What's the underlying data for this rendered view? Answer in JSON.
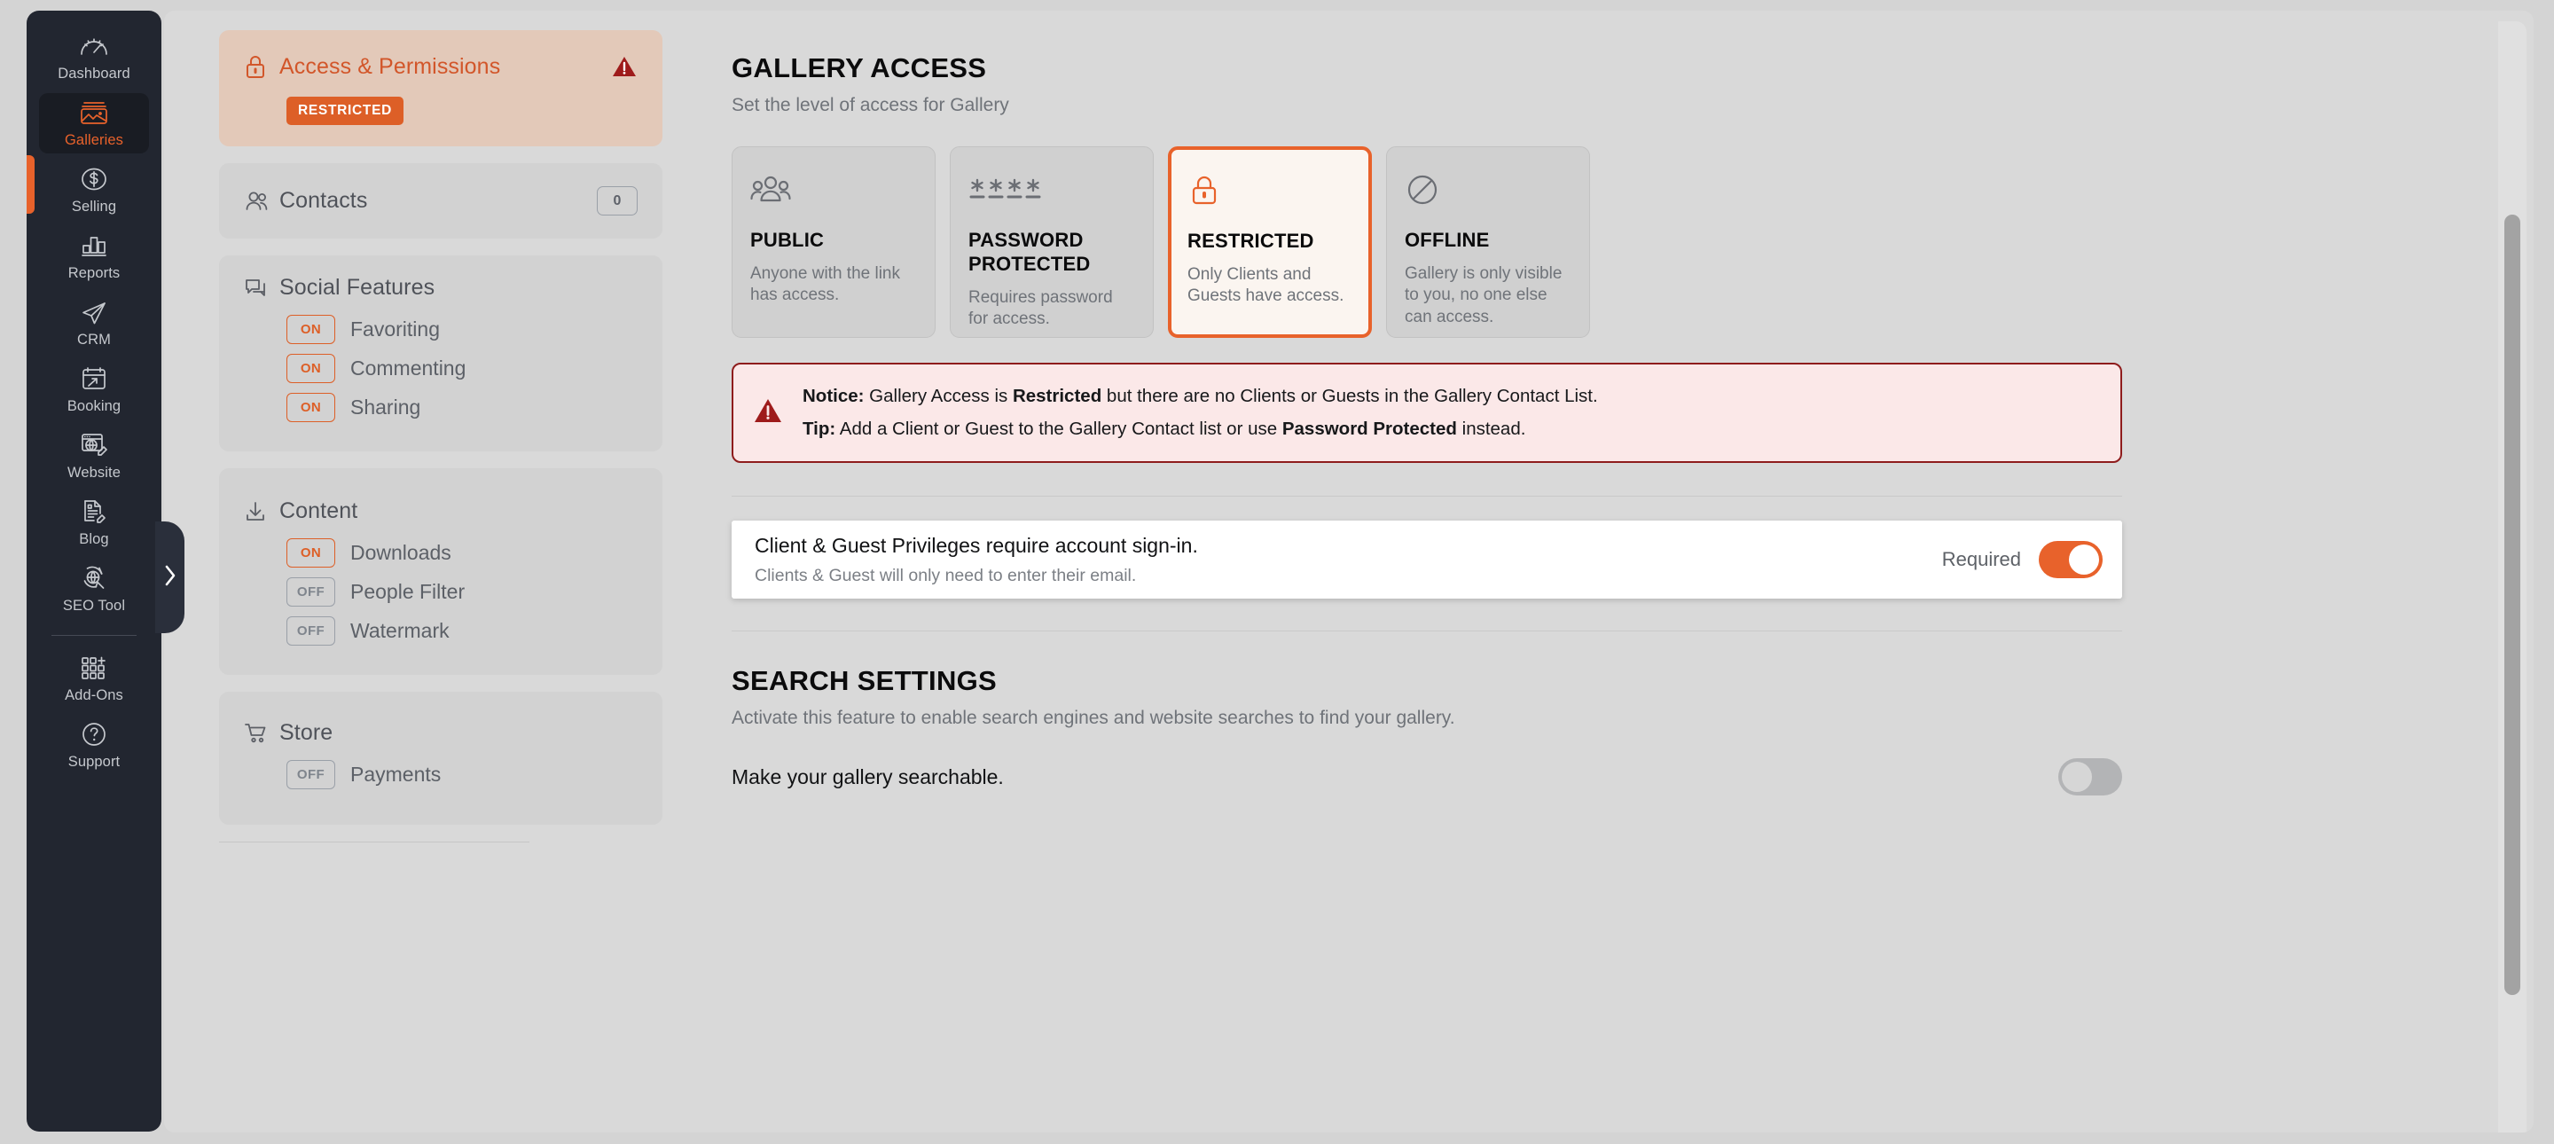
{
  "sidebar": {
    "items": [
      {
        "label": "Dashboard",
        "icon": "gauge-icon",
        "active": false
      },
      {
        "label": "Galleries",
        "icon": "image-stack-icon",
        "active": true
      },
      {
        "label": "Selling",
        "icon": "dollar-circle-icon",
        "active": false
      },
      {
        "label": "Reports",
        "icon": "bar-chart-icon",
        "active": false
      },
      {
        "label": "CRM",
        "icon": "paper-plane-icon",
        "active": false
      },
      {
        "label": "Booking",
        "icon": "calendar-arrow-icon",
        "active": false
      },
      {
        "label": "Website",
        "icon": "browser-globe-pencil-icon",
        "active": false
      },
      {
        "label": "Blog",
        "icon": "document-pencil-icon",
        "active": false
      },
      {
        "label": "SEO Tool",
        "icon": "globe-refresh-search-icon",
        "active": false
      },
      {
        "label": "Add-Ons",
        "icon": "grid-plus-icon",
        "active": false
      },
      {
        "label": "Support",
        "icon": "question-circle-icon",
        "active": false
      }
    ],
    "collapse_icon": "chevron-right-icon",
    "accent_color": "#e8622b",
    "background_color": "#222630"
  },
  "settings_panel": {
    "access": {
      "icon": "lock-icon",
      "title": "Access & Permissions",
      "warning_icon": "warning-triangle-icon",
      "badge": "RESTRICTED",
      "badge_color": "#dd5f27",
      "panel_color": "#e3c9b9"
    },
    "contacts": {
      "icon": "people-icon",
      "title": "Contacts",
      "count": "0"
    },
    "social": {
      "icon": "chat-bubbles-icon",
      "title": "Social Features",
      "features": [
        {
          "state": "ON",
          "label": "Favoriting"
        },
        {
          "state": "ON",
          "label": "Commenting"
        },
        {
          "state": "ON",
          "label": "Sharing"
        }
      ]
    },
    "content": {
      "icon": "download-icon",
      "title": "Content",
      "features": [
        {
          "state": "ON",
          "label": "Downloads"
        },
        {
          "state": "OFF",
          "label": "People Filter"
        },
        {
          "state": "OFF",
          "label": "Watermark"
        }
      ]
    },
    "store": {
      "icon": "shopping-cart-icon",
      "title": "Store",
      "features": [
        {
          "state": "OFF",
          "label": "Payments"
        }
      ]
    }
  },
  "gallery_access": {
    "title": "GALLERY ACCESS",
    "subtitle": "Set the level of access for Gallery",
    "options": [
      {
        "icon": "people-group-icon",
        "name": "PUBLIC",
        "description": "Anyone with the link has access.",
        "selected": false
      },
      {
        "icon": "password-asterisks-icon",
        "name": "PASSWORD PROTECTED",
        "description": "Requires password for access.",
        "selected": false
      },
      {
        "icon": "lock-icon",
        "name": "RESTRICTED",
        "description": "Only Clients and Guests have access.",
        "selected": true
      },
      {
        "icon": "no-entry-icon",
        "name": "OFFLINE",
        "description": "Gallery is only visible to you, no one else can access.",
        "selected": false
      }
    ],
    "selected_color": "#e8622b"
  },
  "notice": {
    "icon": "warning-triangle-icon",
    "line1_prefix": "Notice:",
    "line1_a": " Gallery Access is ",
    "line1_strong": "Restricted",
    "line1_b": " but there are no Clients or Guests in the Gallery Contact List.",
    "line2_prefix": "Tip:",
    "line2_a": " Add a Client or Guest to the Gallery Contact list or use ",
    "line2_strong": "Password Protected",
    "line2_b": " instead.",
    "border_color": "#8e1c1c",
    "background_color": "#fbe8e8"
  },
  "privileges": {
    "title": "Client & Guest Privileges require account sign-in.",
    "subtitle": "Clients & Guest will only need to enter their email.",
    "toggle_label": "Required",
    "toggle_state": "on"
  },
  "search_settings": {
    "title": "SEARCH SETTINGS",
    "subtitle": "Activate this feature to enable search engines and website searches to find your gallery.",
    "row_label": "Make your gallery searchable.",
    "toggle_state": "off"
  }
}
